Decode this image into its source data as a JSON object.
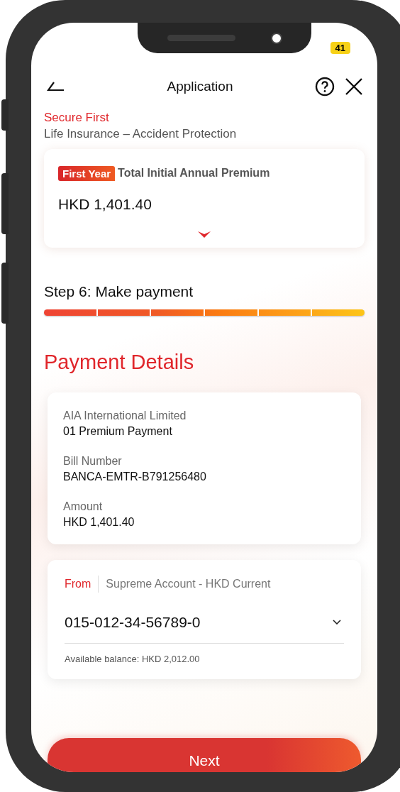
{
  "status_bar": {
    "battery": "41"
  },
  "header": {
    "title": "Application"
  },
  "product": {
    "name": "Secure First",
    "type": "Life Insurance – Accident Protection"
  },
  "premium_card": {
    "badge": "First Year",
    "label": "Total Initial Annual Premium",
    "amount": "HKD 1,401.40",
    "expanded": false
  },
  "progress": {
    "step": "Step 6: Make payment",
    "level": 1
  },
  "section_title": "Payment Details",
  "details": [
    {
      "label": "AIA International Limited",
      "value": "01 Premium Payment"
    },
    {
      "label": "Bill Number",
      "value": "BANCA-EMTR-B791256480"
    },
    {
      "label": "Amount",
      "value": "HKD 1,401.40"
    }
  ],
  "from_account": {
    "label": "From",
    "account_name": "Supreme Account - HKD Current",
    "account_number": "015-012-34-56789-0",
    "balance": "Available balance: HKD 2,012.00"
  },
  "primary_button": "Next"
}
